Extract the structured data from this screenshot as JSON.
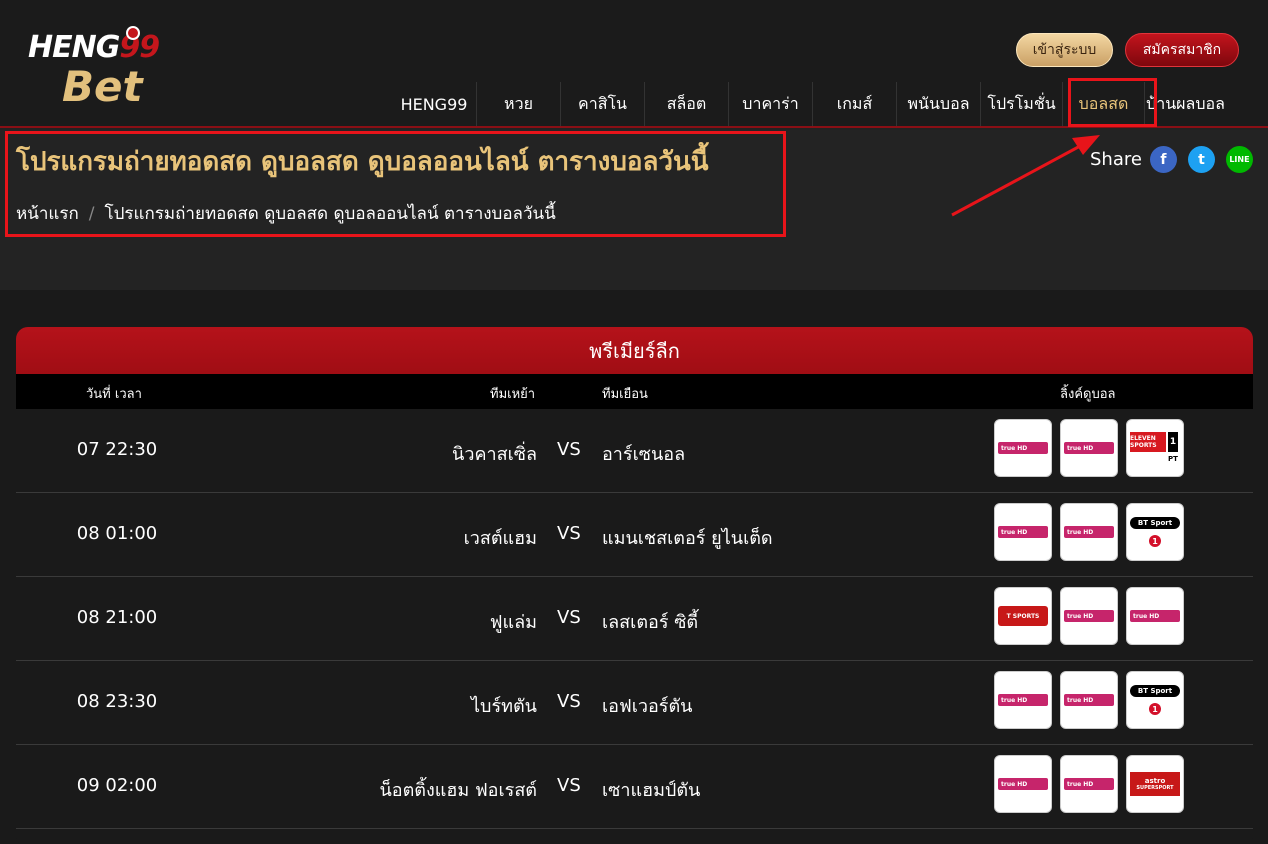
{
  "logo": {
    "line1_a": "HENG",
    "line1_b": "99",
    "line2": "Bet"
  },
  "auth": {
    "login_label": "เข้าสู่ระบบ",
    "register_label": "สมัครสมาชิก"
  },
  "nav": {
    "items": [
      {
        "label": "HENG99"
      },
      {
        "label": "หวย"
      },
      {
        "label": "คาสิโน"
      },
      {
        "label": "สล็อต"
      },
      {
        "label": "บาคาร่า"
      },
      {
        "label": "เกมส์"
      },
      {
        "label": "พนันบอล"
      },
      {
        "label": "โปรโมชั่น"
      },
      {
        "label": "บอลสด"
      },
      {
        "label": "บ้านผลบอล"
      }
    ],
    "active_label": "บอลสด"
  },
  "page": {
    "title": "โปรแกรมถ่ายทอดสด ดูบอลสด ดูบอลออนไลน์ ตารางบอลวันนี้",
    "breadcrumb_home": "หน้าแรก",
    "breadcrumb_sep": "/",
    "breadcrumb_current": "โปรแกรมถ่ายทอดสด ดูบอลสด ดูบอลออนไลน์ ตารางบอลวันนี้"
  },
  "share": {
    "label": "Share",
    "facebook": "f",
    "twitter": "t",
    "line": "LINE"
  },
  "league": {
    "name": "พรีเมียร์ลีก",
    "headers": {
      "datetime": "วันที่ เวลา",
      "home": "ทีมเหย้า",
      "away": "ทีมเยือน",
      "links": "ลิ้งค์ดูบอล"
    },
    "vs_label": "VS",
    "matches": [
      {
        "time": "07 22:30",
        "home": "นิวคาสเซิ่ล",
        "away": "อาร์เซนอล"
      },
      {
        "time": "08 01:00",
        "home": "เวสต์แฮม",
        "away": "แมนเชสเตอร์ ยูไนเต็ด"
      },
      {
        "time": "08 21:00",
        "home": "ฟูแล่ม",
        "away": "เลสเตอร์ ซิตี้"
      },
      {
        "time": "08 23:30",
        "home": "ไบร์ทตัน",
        "away": "เอฟเวอร์ตัน"
      },
      {
        "time": "09 02:00",
        "home": "น็อตติ้งแฮม ฟอเรสต์",
        "away": "เซาแฮมป์ตัน"
      }
    ]
  },
  "channels": {
    "truevisions": "true HD",
    "eleven_logo": "ELEVEN SPORTS",
    "eleven_num": "1",
    "eleven_pt": "PT",
    "bt_logo": "BT Sport",
    "bt_num": "1",
    "tsport": "T SPORTS",
    "astro": "astro",
    "astro_sub": "SUPERSPORT"
  },
  "colors": {
    "accent_gold": "#e9c47a",
    "brand_red": "#b5121a",
    "highlight": "#e8141a"
  }
}
